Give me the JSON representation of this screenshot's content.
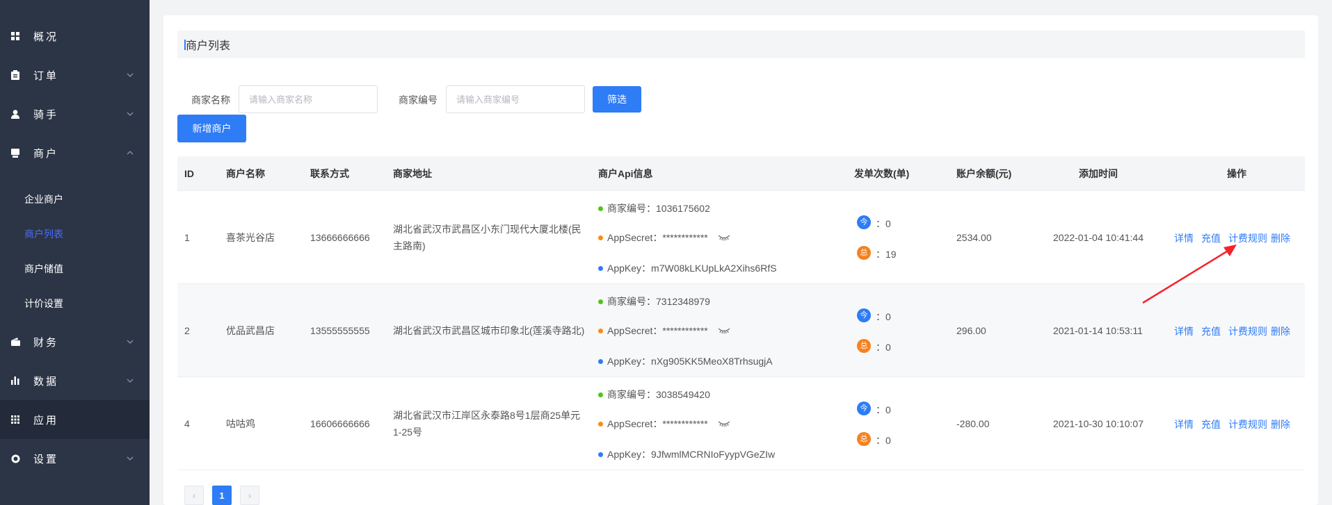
{
  "sidebar": {
    "items": [
      {
        "label": "概况",
        "icon": "grid-icon"
      },
      {
        "label": "订单",
        "icon": "clipboard-icon"
      },
      {
        "label": "骑手",
        "icon": "user-icon"
      },
      {
        "label": "商户",
        "icon": "store-icon"
      },
      {
        "label": "财务",
        "icon": "wallet-icon"
      },
      {
        "label": "数据",
        "icon": "bar-chart-icon"
      },
      {
        "label": "应用",
        "icon": "apps-icon"
      },
      {
        "label": "设置",
        "icon": "gear-icon"
      }
    ],
    "sub_items": [
      {
        "label": "企业商户"
      },
      {
        "label": "商户列表",
        "active": true
      },
      {
        "label": "商户储值"
      },
      {
        "label": "计价设置"
      }
    ],
    "active_color": "#4c6ef5"
  },
  "page": {
    "title": "商户列表"
  },
  "filter": {
    "name_label": "商家名称",
    "name_placeholder": "请输入商家名称",
    "code_label": "商家编号",
    "code_placeholder": "请输入商家编号",
    "filter_button": "筛选",
    "add_button": "新增商户"
  },
  "table": {
    "headers": [
      "ID",
      "商户名称",
      "联系方式",
      "商家地址",
      "商户Api信息",
      "发单次数(单)",
      "账户余额(元)",
      "添加时间",
      "操作"
    ],
    "rows": [
      {
        "id": "1",
        "name": "喜茶光谷店",
        "phone": "13666666666",
        "address": "湖北省武汉市武昌区小东门现代大厦北楼(民主路南)",
        "merchant_code": "商家编号：1036175602",
        "app_secret": "AppSecret：************",
        "app_key": "AppKey：m7W08kLKUpLkA2Xihs6RfS",
        "today_badge": "今",
        "today_count": "：0",
        "total_badge": "总",
        "total_count": "：19",
        "balance": "2534.00",
        "added_time": "2022-01-04 10:41:44"
      },
      {
        "id": "2",
        "name": "优品武昌店",
        "phone": "13555555555",
        "address": "湖北省武汉市武昌区城市印象北(莲溪寺路北)",
        "merchant_code": "商家编号：7312348979",
        "app_secret": "AppSecret：************",
        "app_key": "AppKey：nXg905KK5MeoX8TrhsugjA",
        "today_badge": "今",
        "today_count": "：0",
        "total_badge": "总",
        "total_count": "：0",
        "balance": "296.00",
        "added_time": "2021-01-14 10:53:11"
      },
      {
        "id": "4",
        "name": "咕咕鸡",
        "phone": "16606666666",
        "address": "湖北省武汉市江岸区永泰路8号1层商25单元1-25号",
        "merchant_code": "商家编号：3038549420",
        "app_secret": "AppSecret：************",
        "app_key": "AppKey：9JfwmlMCRNIoFyypVGeZIw",
        "today_badge": "今",
        "today_count": "：0",
        "total_badge": "总",
        "total_count": "：0",
        "balance": "-280.00",
        "added_time": "2021-10-30 10:10:07"
      }
    ],
    "actions": {
      "detail": "详情",
      "recharge": "充值",
      "billing_rule": "计费规则",
      "delete": "删除"
    }
  },
  "pagination": {
    "prev": "‹",
    "current": "1",
    "next": "›"
  },
  "colors": {
    "primary": "#2e7cf6",
    "sidebar_bg": "#2c3546",
    "dot_green": "#52c41a",
    "dot_orange": "#fa8c16",
    "dot_blue": "#2e7cf6",
    "badge_blue": "#2e7cf6",
    "badge_orange": "#f5821f",
    "annotation_arrow": "#f5222d"
  }
}
